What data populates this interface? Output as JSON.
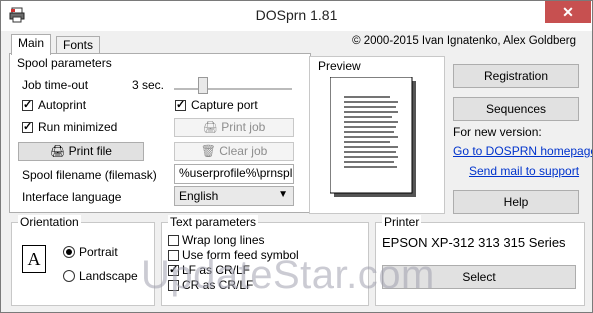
{
  "window": {
    "title": "DOSprn 1.81",
    "close_glyph": "✕",
    "app_icon": "printer-app-icon"
  },
  "tabs": [
    {
      "label": "Main",
      "active": true
    },
    {
      "label": "Fonts",
      "active": false
    }
  ],
  "copyright": "© 2000-2015 Ivan Ignatenko, Alex Goldberg",
  "spool": {
    "group_label": "Spool parameters",
    "job_timeout_label": "Job time-out",
    "job_timeout_value": "3 sec.",
    "autoprint_label": "Autoprint",
    "autoprint_checked": true,
    "capture_port_label": "Capture port",
    "capture_port_checked": true,
    "run_minimized_label": "Run minimized",
    "run_minimized_checked": true,
    "print_job_label": "Print job",
    "clear_job_label": "Clear job",
    "print_file_label": "Print file",
    "spool_filename_label": "Spool filename (filemask)",
    "spool_filename_value": "%userprofile%\\prnspl",
    "interface_language_label": "Interface language",
    "interface_language_value": "English"
  },
  "preview": {
    "label": "Preview"
  },
  "right": {
    "registration_label": "Registration",
    "sequences_label": "Sequences",
    "new_version_label": "For new version:",
    "homepage_link": "Go to DOSPRN homepage",
    "support_link": "Send mail to support",
    "help_label": "Help"
  },
  "orientation": {
    "label": "Orientation",
    "icon_letter": "A",
    "portrait_label": "Portrait",
    "landscape_label": "Landscape",
    "selected": "Portrait"
  },
  "text_params": {
    "label": "Text parameters",
    "wrap_label": "Wrap long lines",
    "wrap_checked": false,
    "formfeed_label": "Use form feed symbol",
    "formfeed_checked": false,
    "lf_label": "LF as CR/LF",
    "lf_checked": true,
    "cr_label": "CR as CR/LF",
    "cr_checked": false
  },
  "printer": {
    "label": "Printer",
    "name": "EPSON XP-312 313 315 Series",
    "select_label": "Select"
  },
  "watermark": "UpdateStar.com"
}
